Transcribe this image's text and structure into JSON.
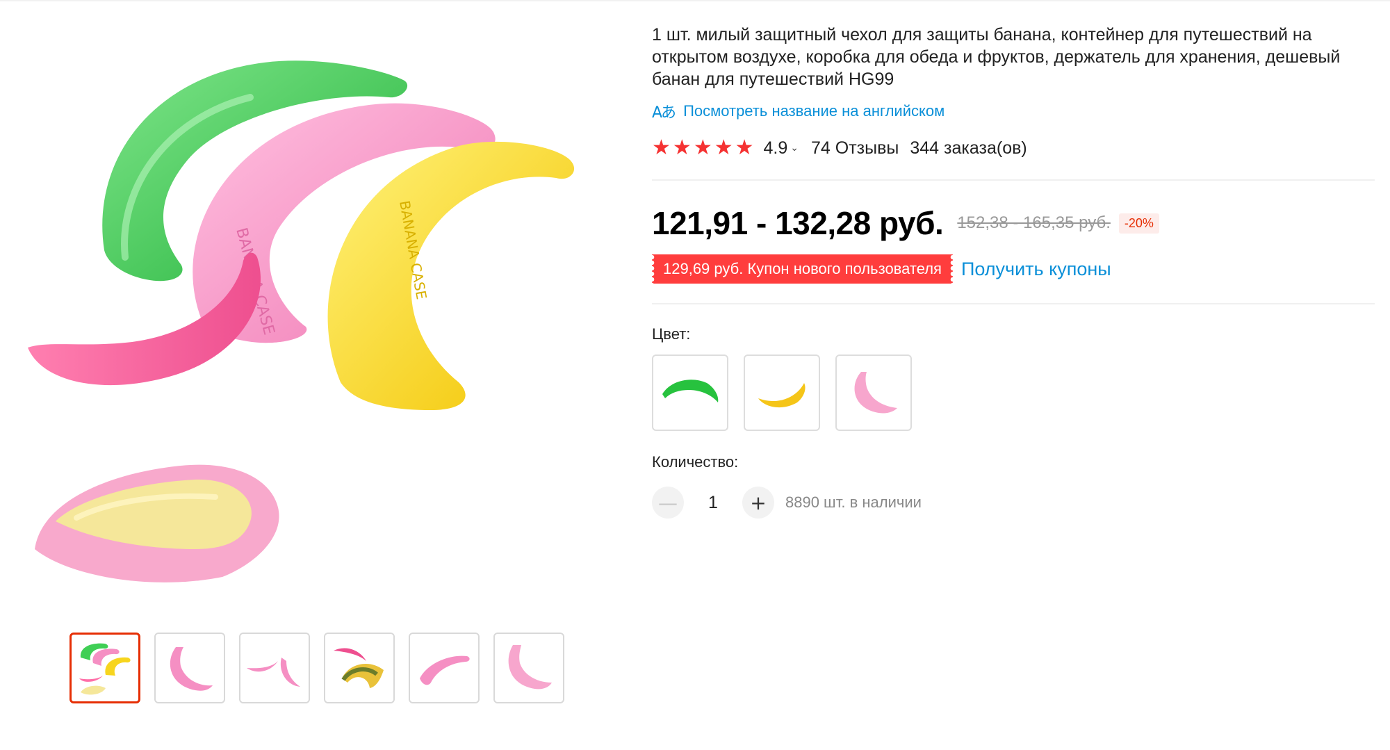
{
  "product": {
    "title": "1 шт. милый защитный чехол для защиты банана, контейнер для путешествий на открытом воздухе, коробка для обеда и фруктов, держатель для хранения, дешевый банан для путешествий HG99",
    "translate_icon": "Аあ",
    "translate_link": "Посмотреть название на английском",
    "rating": "4.9",
    "reviews": "74 Отзывы",
    "orders": "344 заказа(ов)",
    "price": "121,91 - 132,28 руб.",
    "old_price": "152,38 - 165,35 руб.",
    "discount": "-20%",
    "coupon": "129,69 руб. Купон нового пользователя",
    "get_coupons": "Получить купоны",
    "color_label": "Цвет:",
    "quantity_label": "Количество:",
    "quantity_value": "1",
    "minus": "—",
    "plus": "+",
    "stock": "8890 шт. в наличии",
    "case_text": "BANANA CASE"
  },
  "gallery": {
    "thumbnails": [
      "all-colors",
      "pink-open",
      "pink-split",
      "pink-with-banana",
      "pink-side",
      "pink-front"
    ],
    "active_index": 0
  },
  "colors": {
    "options": [
      "green",
      "yellow",
      "pink"
    ],
    "green": "#3fcf55",
    "pink": "#f58fc3",
    "yellow": "#f7d51e",
    "accent_red": "#f53232",
    "link_blue": "#0a8fd8"
  },
  "icons": {
    "star": "★",
    "chevron": "⌄"
  }
}
